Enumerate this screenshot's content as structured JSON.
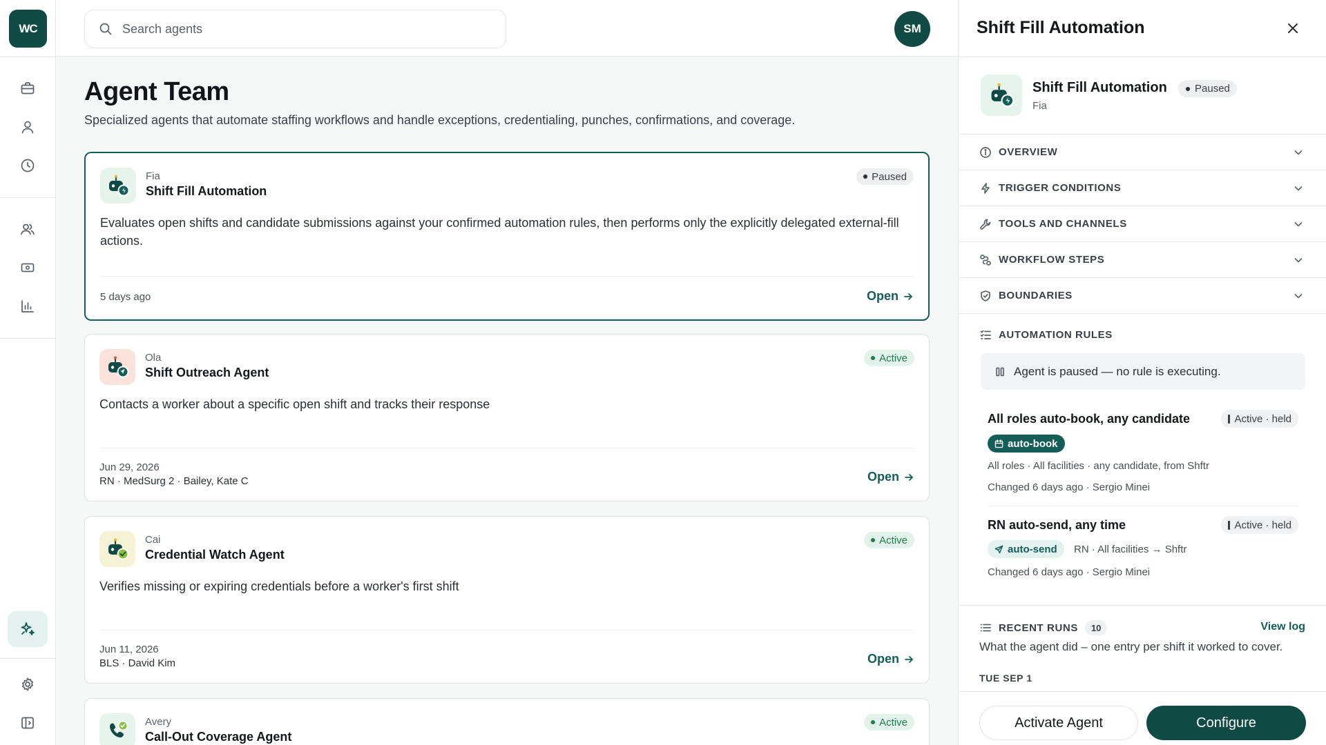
{
  "app": {
    "logo_text": "WC",
    "user_initials": "SM"
  },
  "search": {
    "placeholder": "Search agents"
  },
  "page": {
    "title": "Agent Team",
    "subtitle": "Specialized agents that automate staffing workflows and handle exceptions, credentialing, punches, confirmations, and coverage."
  },
  "agents": [
    {
      "owner": "Fia",
      "title": "Shift Fill Automation",
      "status": "Paused",
      "description": "Evaluates open shifts and candidate submissions against your confirmed automation rules, then performs only the explicitly delegated external-fill actions.",
      "meta_line1": "5 days ago",
      "meta_line2": "",
      "open_label": "Open"
    },
    {
      "owner": "Ola",
      "title": "Shift Outreach Agent",
      "status": "Active",
      "description": "Contacts a worker about a specific open shift and tracks their response",
      "meta_line1": "Jun 29, 2026",
      "meta_line2": "RN · MedSurg 2 · Bailey, Kate C",
      "open_label": "Open"
    },
    {
      "owner": "Cai",
      "title": "Credential Watch Agent",
      "status": "Active",
      "description": "Verifies missing or expiring credentials before a worker's first shift",
      "meta_line1": "Jun 11, 2026",
      "meta_line2": "BLS · David Kim",
      "open_label": "Open"
    },
    {
      "owner": "Avery",
      "title": "Call-Out Coverage Agent",
      "status": "Active",
      "description": "",
      "meta_line1": "",
      "meta_line2": "",
      "open_label": "Open"
    }
  ],
  "panel": {
    "title": "Shift Fill Automation",
    "agent_name": "Shift Fill Automation",
    "agent_owner": "Fia",
    "status": "Paused",
    "sections": [
      "OVERVIEW",
      "TRIGGER CONDITIONS",
      "TOOLS AND CHANNELS",
      "WORKFLOW STEPS",
      "BOUNDARIES"
    ],
    "automation_rules": {
      "heading": "AUTOMATION RULES",
      "paused_notice": "Agent is paused — no rule is executing.",
      "rules": [
        {
          "title": "All roles auto-book, any candidate",
          "status": "Active · held",
          "chip": "auto-book",
          "scope": "All roles · All facilities · any candidate, from Shftr",
          "changed": "Changed 6 days ago · Sergio Minei"
        },
        {
          "title": "RN auto-send, any time",
          "status": "Active · held",
          "chip": "auto-send",
          "scope": "RN · All facilities → Shftr",
          "changed": "Changed 6 days ago · Sergio Minei"
        }
      ]
    },
    "recent_runs": {
      "heading": "RECENT RUNS",
      "count": "10",
      "view_log": "View log",
      "subtitle": "What the agent did – one entry per shift it worked to cover.",
      "date_heading": "TUE SEP 1"
    },
    "buttons": {
      "activate": "Activate Agent",
      "configure": "Configure"
    }
  },
  "colors": {
    "brand": "#0f4a45",
    "accent": "#145e57",
    "active_badge_text": "#1f7a50",
    "active_badge_bg": "#e3f3ec",
    "paused_badge_bg": "#eeeff0"
  }
}
